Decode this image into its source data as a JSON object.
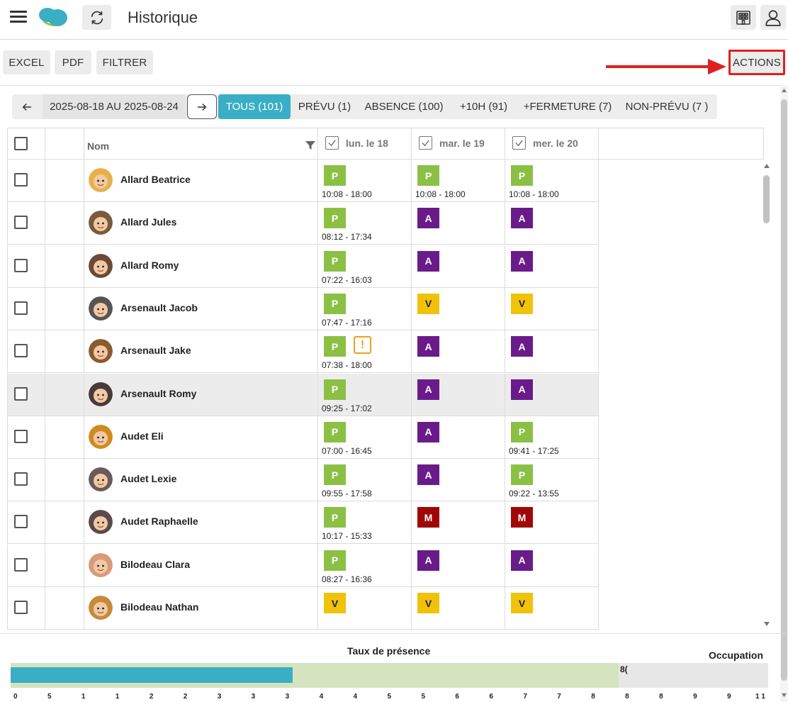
{
  "header": {
    "title": "Historique",
    "icons": [
      "menu-icon",
      "app-logo",
      "refresh-icon",
      "building-icon",
      "user-icon"
    ]
  },
  "toolbar": {
    "excel": "EXCEL",
    "pdf": "PDF",
    "filter": "FILTRER",
    "actions": "ACTIONS"
  },
  "date_nav": {
    "range": "2025-08-18 AU 2025-08-24"
  },
  "tabs": [
    {
      "label": "TOUS (101)",
      "active": true
    },
    {
      "label": "PRÉVU (1)",
      "active": false
    },
    {
      "label": "ABSENCE (100)",
      "active": false
    },
    {
      "label": "+10H (91)",
      "active": false
    },
    {
      "label": "+FERMETURE (7)",
      "active": false
    },
    {
      "label": "NON-PRÉVU (7 )",
      "active": false
    }
  ],
  "grid": {
    "name_header": "Nom",
    "days": [
      "lun. le 18",
      "mar. le 19",
      "mer. le 20"
    ],
    "rows": [
      {
        "name": "Allard Beatrice",
        "avatar_color": "#e8b04a",
        "days": [
          {
            "code": "P",
            "time": "10:08 - 18:00"
          },
          {
            "code": "P",
            "time": "10:08 - 18:00"
          },
          {
            "code": "P",
            "time": "10:08 - 18:00"
          }
        ]
      },
      {
        "name": "Allard Jules",
        "avatar_color": "#7a5a3a",
        "days": [
          {
            "code": "P",
            "time": "08:12 - 17:34"
          },
          {
            "code": "A",
            "time": ""
          },
          {
            "code": "A",
            "time": ""
          }
        ]
      },
      {
        "name": "Allard Romy",
        "avatar_color": "#6a4a36",
        "days": [
          {
            "code": "P",
            "time": "07:22 - 16:03"
          },
          {
            "code": "A",
            "time": ""
          },
          {
            "code": "A",
            "time": ""
          }
        ]
      },
      {
        "name": "Arsenault Jacob",
        "avatar_color": "#555555",
        "days": [
          {
            "code": "P",
            "time": "07:47 - 17:16"
          },
          {
            "code": "V",
            "time": ""
          },
          {
            "code": "V",
            "time": ""
          }
        ]
      },
      {
        "name": "Arsenault Jake",
        "avatar_color": "#8a5a30",
        "warning": true,
        "days": [
          {
            "code": "P",
            "time": "07:38 - 18:00"
          },
          {
            "code": "A",
            "time": ""
          },
          {
            "code": "A",
            "time": ""
          }
        ]
      },
      {
        "name": "Arsenault Romy",
        "avatar_color": "#4a3a3a",
        "highlighted": true,
        "days": [
          {
            "code": "P",
            "time": "09:25 - 17:02"
          },
          {
            "code": "A",
            "time": ""
          },
          {
            "code": "A",
            "time": ""
          }
        ]
      },
      {
        "name": "Audet Eli",
        "avatar_color": "#d08a20",
        "days": [
          {
            "code": "P",
            "time": "07:00 - 16:45"
          },
          {
            "code": "A",
            "time": ""
          },
          {
            "code": "P",
            "time": "09:41 - 17:25"
          }
        ]
      },
      {
        "name": "Audet Lexie",
        "avatar_color": "#6a5a5a",
        "days": [
          {
            "code": "P",
            "time": "09:55 - 17:58"
          },
          {
            "code": "A",
            "time": ""
          },
          {
            "code": "P",
            "time": "09:22 - 13:55"
          }
        ]
      },
      {
        "name": "Audet Raphaelle",
        "avatar_color": "#5a4a4a",
        "days": [
          {
            "code": "P",
            "time": "10:17 - 15:33"
          },
          {
            "code": "M",
            "time": ""
          },
          {
            "code": "M",
            "time": ""
          }
        ]
      },
      {
        "name": "Bilodeau Clara",
        "avatar_color": "#d89a7a",
        "days": [
          {
            "code": "P",
            "time": "08:27 - 16:36"
          },
          {
            "code": "A",
            "time": ""
          },
          {
            "code": "A",
            "time": ""
          }
        ]
      },
      {
        "name": "Bilodeau Nathan",
        "avatar_color": "#c88a3a",
        "days": [
          {
            "code": "V",
            "time": ""
          },
          {
            "code": "V",
            "time": ""
          },
          {
            "code": "V",
            "time": ""
          }
        ]
      }
    ]
  },
  "summary": {
    "presence_title": "Taux de présence",
    "occupation_title": "Occupation",
    "presence_fraction": 0.372,
    "occupation_fraction": 0.803,
    "bar_label": "8(",
    "ticks": [
      "0",
      "5",
      "1",
      "1",
      "2",
      "2",
      "3",
      "3",
      "3",
      "4",
      "4",
      "5",
      "5",
      "6",
      "6",
      "7",
      "7",
      "8",
      "8",
      "8",
      "9",
      "9",
      "1 1"
    ]
  },
  "colors": {
    "accent": "#3aaec5",
    "present": "#8bc045",
    "absent": "#6a1b8a",
    "vacation": "#f0c20a",
    "sick": "#a00808",
    "annotation": "#e02020"
  }
}
